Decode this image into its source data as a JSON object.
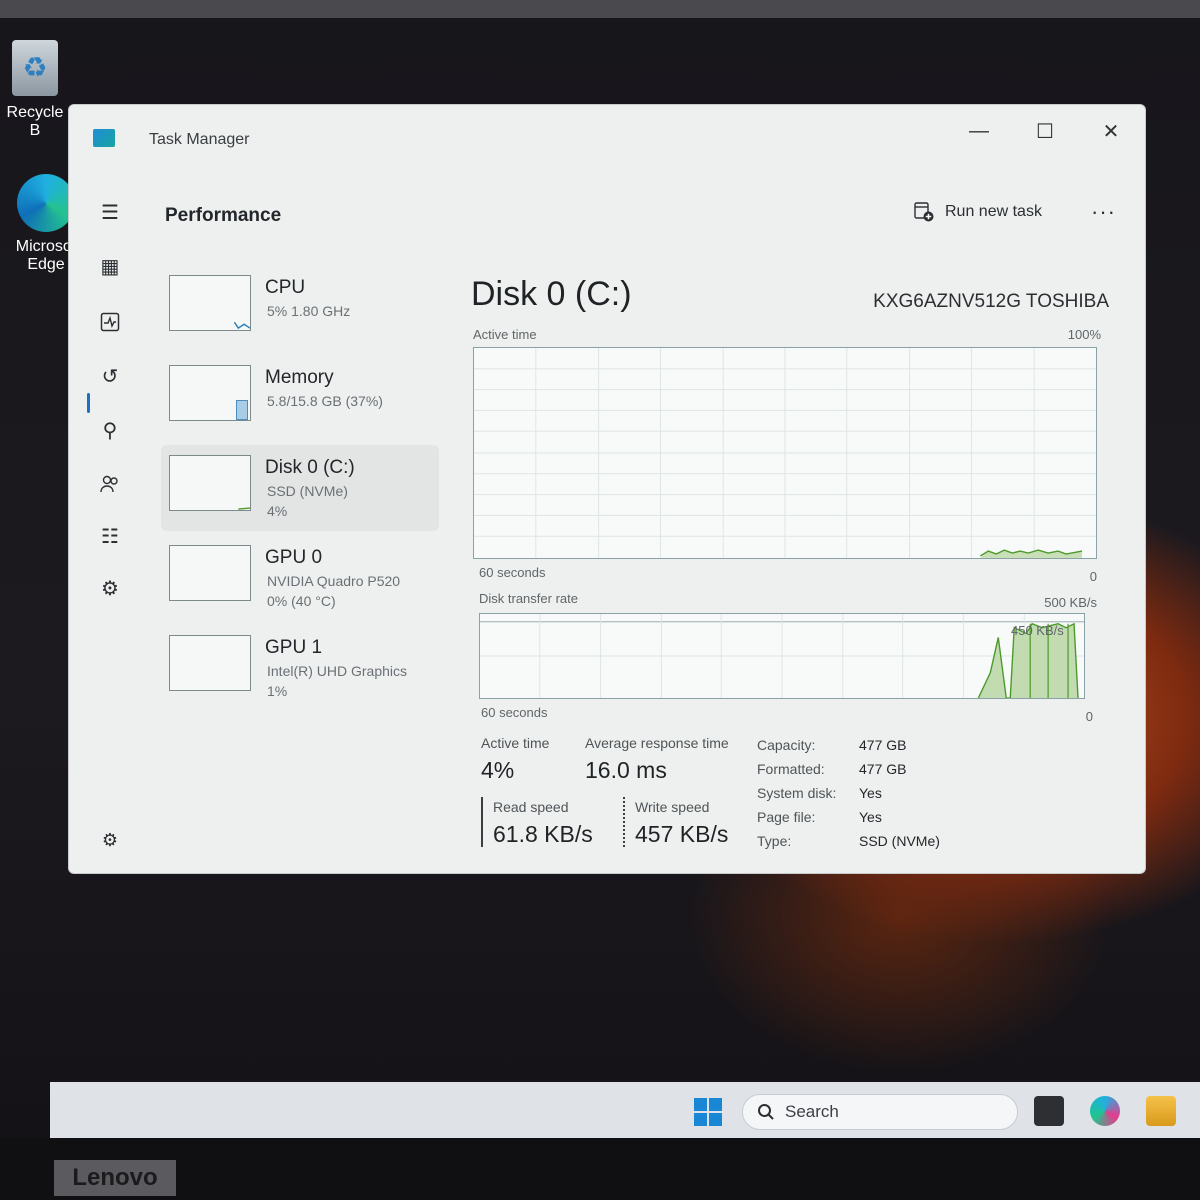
{
  "desktop": {
    "recycle_bin_label": "Recycle B",
    "edge_label_1": "Microsof",
    "edge_label_2": "Edge",
    "brand": "Lenovo"
  },
  "window": {
    "title": "Task Manager",
    "minimize": "—",
    "maximize": "☐",
    "close": "✕"
  },
  "toolbar": {
    "page_title": "Performance",
    "run_new_task": "Run new task",
    "more": "···"
  },
  "sidebar": {
    "items": [
      {
        "name": "CPU",
        "sub": "5%  1.80 GHz",
        "sub2": ""
      },
      {
        "name": "Memory",
        "sub": "5.8/15.8 GB (37%)",
        "sub2": ""
      },
      {
        "name": "Disk 0 (C:)",
        "sub": "SSD (NVMe)",
        "sub2": "4%"
      },
      {
        "name": "GPU 0",
        "sub": "NVIDIA Quadro P520",
        "sub2": "0%  (40 °C)"
      },
      {
        "name": "GPU 1",
        "sub": "Intel(R) UHD Graphics",
        "sub2": "1%"
      }
    ]
  },
  "main": {
    "title": "Disk 0 (C:)",
    "model": "KXG6AZNV512G TOSHIBA",
    "active_graph": {
      "label": "Active time",
      "max": "100%",
      "time_span": "60 seconds",
      "min": "0"
    },
    "transfer_graph": {
      "label": "Disk transfer rate",
      "max": "500 KB/s",
      "mid_label": "450 KB/s",
      "time_span": "60 seconds",
      "min": "0"
    },
    "stats": {
      "active_time_label": "Active time",
      "active_time_value": "4%",
      "avg_response_label": "Average response time",
      "avg_response_value": "16.0 ms",
      "read_speed_label": "Read speed",
      "read_speed_value": "61.8 KB/s",
      "write_speed_label": "Write speed",
      "write_speed_value": "457 KB/s"
    },
    "properties": [
      {
        "key": "Capacity:",
        "value": "477 GB"
      },
      {
        "key": "Formatted:",
        "value": "477 GB"
      },
      {
        "key": "System disk:",
        "value": "Yes"
      },
      {
        "key": "Page file:",
        "value": "Yes"
      },
      {
        "key": "Type:",
        "value": "SSD (NVMe)"
      }
    ]
  },
  "taskbar": {
    "search_placeholder": "Search"
  },
  "colors": {
    "accent": "#1b6fc4",
    "disk_graph_line": "#4c9a2a",
    "disk_graph_fill": "#c9dfb8"
  }
}
